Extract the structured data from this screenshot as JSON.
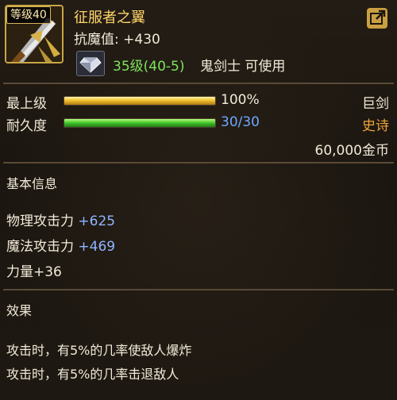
{
  "item": {
    "level_tag": "等级40",
    "name": "征服者之翼",
    "resist_label": "抗魔值",
    "resist_value": ": +430",
    "req_level": "35级(40-5)",
    "req_class": "鬼剑士 可使用",
    "icon": "sword-item-icon",
    "gem_icon": "diamond-icon",
    "share_icon": "share-icon"
  },
  "grade": {
    "label": "最上级",
    "percent": "100%",
    "fill_fraction": 1.0
  },
  "durability": {
    "label": "耐久度",
    "value": "30/30",
    "fill_fraction": 1.0
  },
  "item_type": "巨剑",
  "rarity": "史诗",
  "price": "60,000金币",
  "basic_info": {
    "heading": "基本信息",
    "phys_attack_label": "物理攻击力",
    "phys_attack_value": "+625",
    "mag_attack_label": "魔法攻击力",
    "mag_attack_value": "+469",
    "strength": "力量+36"
  },
  "effects": {
    "heading": "效果",
    "lines": [
      "攻击时，有5%的几率使敌人爆炸",
      "攻击时，有5%的几率击退敌人"
    ]
  },
  "colors": {
    "title": "#ffd56a",
    "rarity": "#f0a43a",
    "stat_value": "#8fb6ff",
    "req_level": "#7ee35c"
  }
}
